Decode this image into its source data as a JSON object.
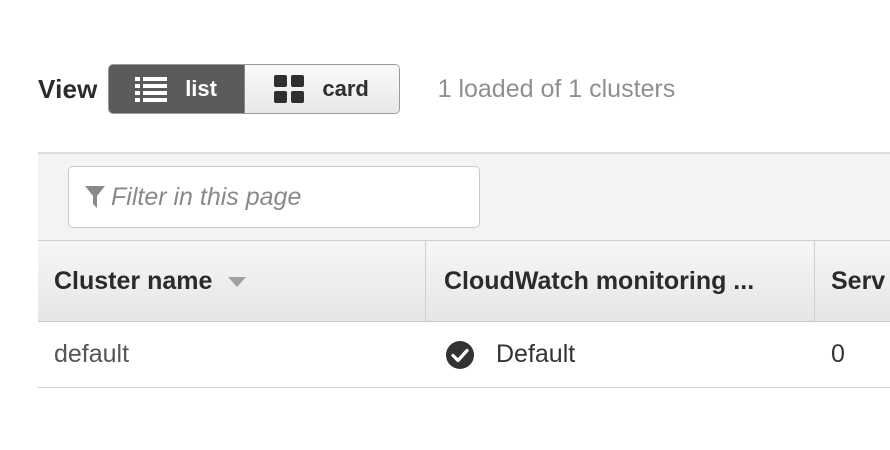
{
  "view": {
    "label": "View",
    "list_label": "list",
    "card_label": "card",
    "count_text": "1 loaded of 1 clusters"
  },
  "filter": {
    "placeholder": "Filter in this page"
  },
  "table": {
    "columns": [
      "Cluster name",
      "CloudWatch monitoring ...",
      "Serv"
    ],
    "rows": [
      {
        "name": "default",
        "monitoring": "Default",
        "services": "0"
      }
    ]
  },
  "colors": {
    "active_toggle": "#5b5b5b",
    "header_bg": "#eeeeee",
    "muted_text": "#8f8f8f"
  }
}
